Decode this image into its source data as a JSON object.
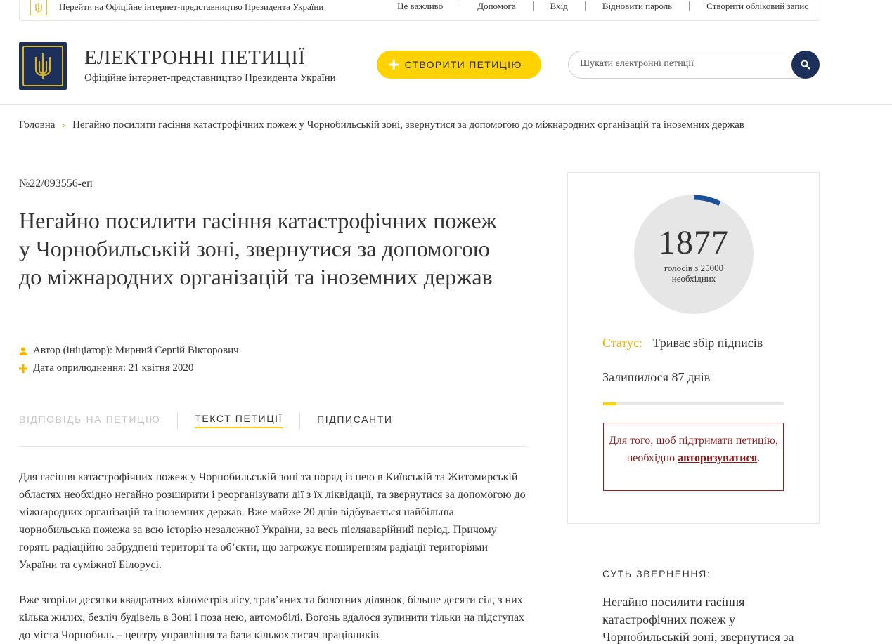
{
  "topbar": {
    "official_link": "Перейти на Офіційне інтернет-представництво Президента України",
    "links": [
      "Це важливо",
      "Допомога",
      "Вхід",
      "Відновити пароль",
      "Створити обліковий запис"
    ]
  },
  "header": {
    "title": "ЕЛЕКТРОННІ ПЕТИЦІЇ",
    "subtitle": "Офіційне інтернет-представництво Президента України",
    "create_button": "СТВОРИТИ ПЕТИЦІЮ",
    "search_placeholder": "Шукати електронні петиції"
  },
  "breadcrumb": {
    "home": "Головна",
    "current": "Негайно посилити гасіння катастрофічних пожеж у Чорнобильській зоні, звернутися за допомогою до міжнародних організацій та іноземних держав"
  },
  "petition": {
    "number": "№22/093556-еп",
    "title": "Негайно посилити гасіння катастрофічних пожеж у Чорнобильській зоні, звернутися за допомогою до міжнародних організацій та іноземних держав",
    "author": "Автор (ініціатор): Мирний Сергій Вікторович",
    "date": "Дата оприлюднення: 21 квітня 2020",
    "tabs": {
      "response": "ВІДПОВІДЬ НА ПЕТИЦІЮ",
      "text": "ТЕКСТ ПЕТИЦІЇ",
      "signers": "ПІДПИСАНТИ"
    },
    "body": [
      "Для гасіння катастрофічних пожеж у Чорнобильській зоні та поряд із нею в Київській та Житомирській областях необхідно негайно розширити і реорганізувати дії з їх ліквідації, та звернутися за допомогою до міжнародних організацій та іноземних держав. Вже майже 20 днів відбувається найбільша чорнобильська пожежа за всю історію незалежної України, за весь післяаварійний період. Причому горять радіаційно забруднені території та об’єкти, що загрожує поширенням радіації територіями України та суміжної Білорусі.",
      "Вже згоріли десятки квадратних кілометрів лісу, трав’яних та болотних ділянок, більше десяти сіл, з них кілька жилих, безліч будівель в Зоні і поза нею, автомобілі. Вогонь вдалося зупинити тільки на підступах до міста Чорнобиль – центру управління та бази кількох тисяч працівників"
    ]
  },
  "sidebar": {
    "votes": "1877",
    "votes_sub_1": "голосів з 25000",
    "votes_sub_2": "необхідних",
    "votes_fraction": 0.0751,
    "status_label": "Статус:",
    "status_value": "Триває збір підписів",
    "remaining": "Залишилося 87 днів",
    "auth_text_1": "Для того, щоб підтримати петицію, необхідно",
    "auth_link": "авторизуватися",
    "auth_dot": ".",
    "essence_title": "СУТЬ ЗВЕРНЕННЯ:",
    "essence_text": "Негайно посилити гасіння катастрофічних пожеж у Чорнобильській зоні, звернутися за"
  },
  "colors": {
    "navy": "#1d2f5b",
    "yellow": "#ffd200",
    "ring": "#1a4f9c",
    "alert": "#8b1a1a"
  }
}
